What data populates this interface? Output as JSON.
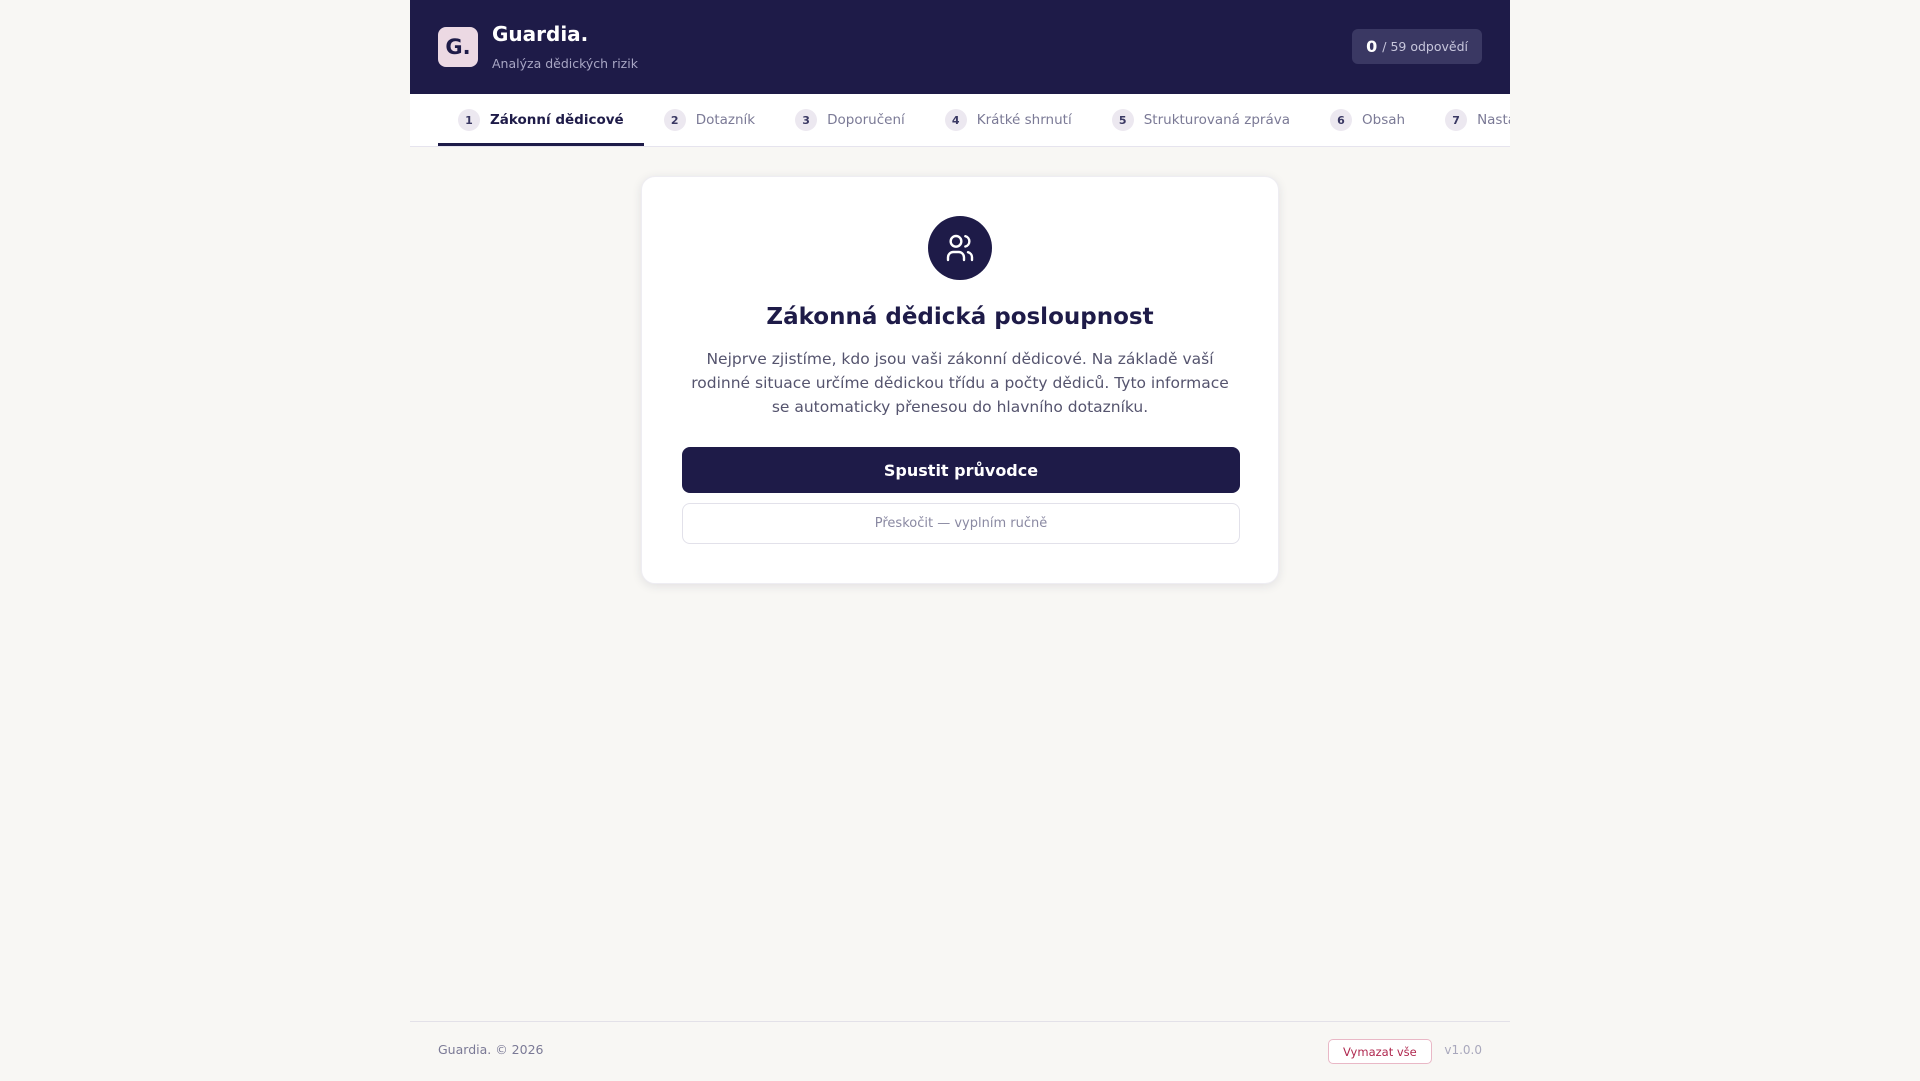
{
  "header": {
    "logo": "G.",
    "brand": "Guardia.",
    "subtitle": "Analýza dědických rizik",
    "counter_value": "0",
    "counter_label": "/ 59 odpovědí"
  },
  "tabs": [
    {
      "num": "1",
      "label": "Zákonní dědicové",
      "active": true
    },
    {
      "num": "2",
      "label": "Dotazník"
    },
    {
      "num": "3",
      "label": "Doporučení"
    },
    {
      "num": "4",
      "label": "Krátké shrnutí"
    },
    {
      "num": "5",
      "label": "Strukturovaná zpráva"
    },
    {
      "num": "6",
      "label": "Obsah"
    },
    {
      "num": "7",
      "label": "Nastavení"
    }
  ],
  "card": {
    "icon": "users-icon",
    "title": "Zákonná dědická posloupnost",
    "text": "Nejprve zjistíme, kdo jsou vaši zákonní dědicové. Na základě vaší rodinné situace určíme dědickou třídu a počty dědiců. Tyto informace se automaticky přenesou do hlavního dotazníku.",
    "primary_button": "Spustit průvodce",
    "secondary_button": "Přeskočit — vyplním ručně"
  },
  "footer": {
    "copyright": "Guardia. © 2026",
    "clear_button": "Vymazat vše",
    "version": "v1.0.0"
  },
  "colors": {
    "primary": "#1e1b48",
    "accent_pink": "#ecd9e3",
    "danger": "#b0284f",
    "background": "#f8f7f4"
  }
}
